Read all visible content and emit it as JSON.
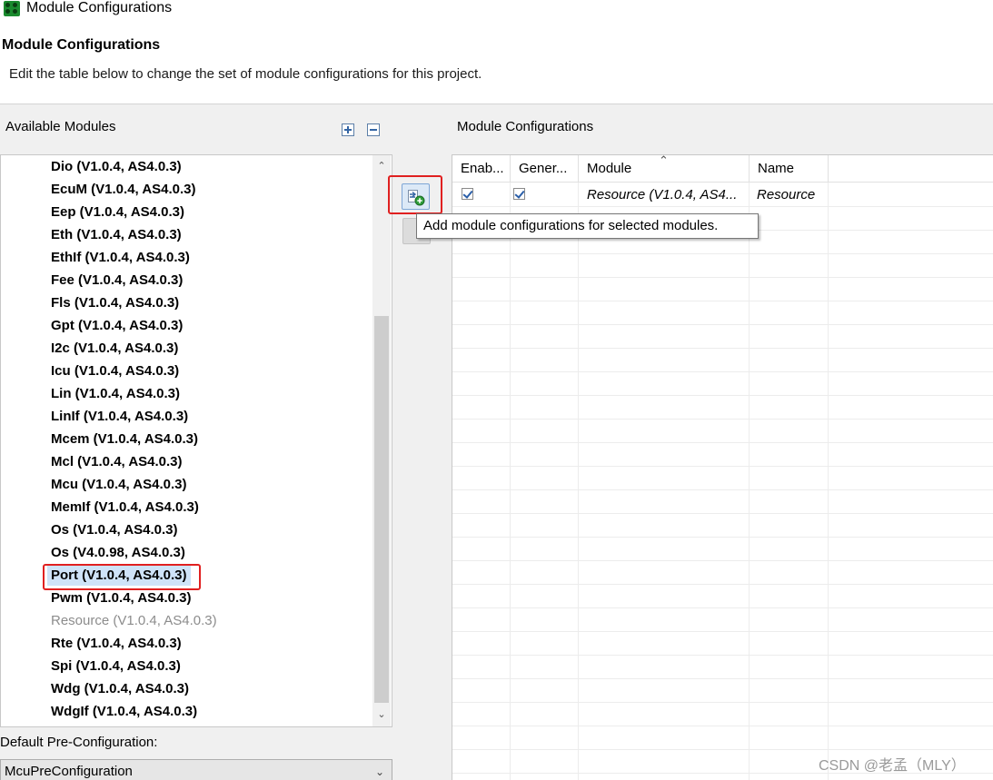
{
  "window": {
    "title": "Module Configurations",
    "icon": "app-grid-icon"
  },
  "page": {
    "title": "Module Configurations",
    "description": "Edit the table below to change the set of module configurations for this project."
  },
  "available_modules": {
    "label": "Available Modules",
    "expand_icon": "expand-all-icon",
    "collapse_icon": "collapse-all-icon",
    "items": [
      {
        "label": "Dio (V1.0.4, AS4.0.3)",
        "state": "normal"
      },
      {
        "label": "EcuM (V1.0.4, AS4.0.3)",
        "state": "normal"
      },
      {
        "label": "Eep (V1.0.4, AS4.0.3)",
        "state": "normal"
      },
      {
        "label": "Eth (V1.0.4, AS4.0.3)",
        "state": "normal"
      },
      {
        "label": "EthIf (V1.0.4, AS4.0.3)",
        "state": "normal"
      },
      {
        "label": "Fee (V1.0.4, AS4.0.3)",
        "state": "normal"
      },
      {
        "label": "Fls (V1.0.4, AS4.0.3)",
        "state": "normal"
      },
      {
        "label": "Gpt (V1.0.4, AS4.0.3)",
        "state": "normal"
      },
      {
        "label": "I2c (V1.0.4, AS4.0.3)",
        "state": "normal"
      },
      {
        "label": "Icu (V1.0.4, AS4.0.3)",
        "state": "normal"
      },
      {
        "label": "Lin (V1.0.4, AS4.0.3)",
        "state": "normal"
      },
      {
        "label": "LinIf (V1.0.4, AS4.0.3)",
        "state": "normal"
      },
      {
        "label": "Mcem (V1.0.4, AS4.0.3)",
        "state": "normal"
      },
      {
        "label": "Mcl (V1.0.4, AS4.0.3)",
        "state": "normal"
      },
      {
        "label": "Mcu (V1.0.4, AS4.0.3)",
        "state": "normal"
      },
      {
        "label": "MemIf (V1.0.4, AS4.0.3)",
        "state": "normal"
      },
      {
        "label": "Os (V1.0.4, AS4.0.3)",
        "state": "normal"
      },
      {
        "label": "Os (V4.0.98, AS4.0.3)",
        "state": "normal"
      },
      {
        "label": "Port (V1.0.4, AS4.0.3)",
        "state": "selected"
      },
      {
        "label": "Pwm (V1.0.4, AS4.0.3)",
        "state": "normal"
      },
      {
        "label": "Resource (V1.0.4, AS4.0.3)",
        "state": "disabled"
      },
      {
        "label": "Rte (V1.0.4, AS4.0.3)",
        "state": "normal"
      },
      {
        "label": "Spi (V1.0.4, AS4.0.3)",
        "state": "normal"
      },
      {
        "label": "Wdg (V1.0.4, AS4.0.3)",
        "state": "normal"
      },
      {
        "label": "WdgIf (V1.0.4, AS4.0.3)",
        "state": "normal"
      }
    ]
  },
  "default_preconfiguration": {
    "label": "Default Pre-Configuration:",
    "value": "McuPreConfiguration"
  },
  "actions": {
    "add_icon": "add-module-config-icon",
    "remove_icon": "remove-module-config-icon",
    "add_tooltip": "Add module configurations for selected modules."
  },
  "module_configurations": {
    "label": "Module Configurations",
    "columns": [
      "Enab...",
      "Gener...",
      "Module",
      "Name"
    ],
    "rows": [
      {
        "enabled": true,
        "generate": true,
        "module": "Resource (V1.0.4, AS4...",
        "name": "Resource"
      }
    ]
  },
  "watermark": "CSDN @老孟（MLY）",
  "colors": {
    "selection": "#cfe3f8",
    "annotation_red": "#e02020",
    "check_blue": "#2a5ea8"
  }
}
